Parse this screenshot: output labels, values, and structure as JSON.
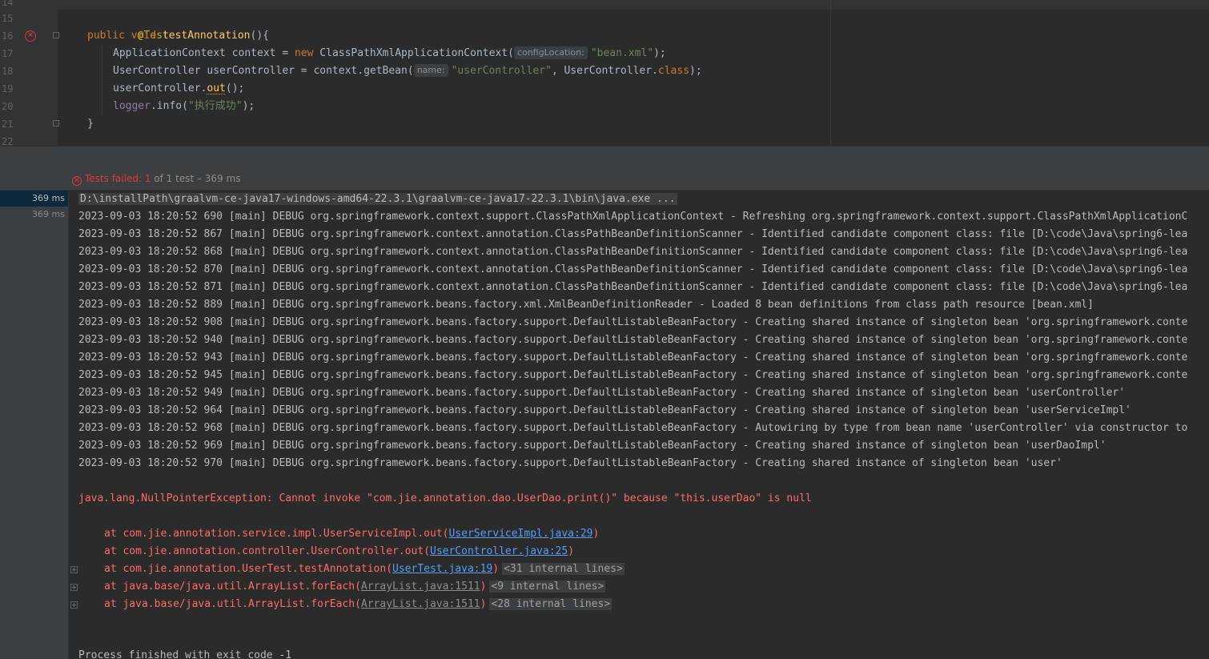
{
  "editor": {
    "line_numbers": [
      "14",
      "15",
      "16",
      "17",
      "18",
      "19",
      "20",
      "21",
      "22"
    ],
    "lines": {
      "l15": {
        "annotation": "@Test"
      },
      "l16": {
        "kw1": "public",
        "kw2": "void",
        "method": "testAnnotation",
        "rest": "(){"
      },
      "l17": {
        "t1": "ApplicationContext context = ",
        "kw": "new",
        "t2": " ClassPathXmlApplicationContext(",
        "hint": "configLocation:",
        "str": "\"bean.xml\"",
        "t3": ");"
      },
      "l18": {
        "t1": "UserController userController = context.getBean(",
        "hint": "name:",
        "str": "\"userController\"",
        "t2": ", UserController.",
        "kw": "class",
        "t3": ");"
      },
      "l19": {
        "t1": "userController.",
        "call": "out",
        "t2": "();"
      },
      "l20": {
        "field": "logger",
        "t1": ".info(",
        "str": "\"执行成功\"",
        "t2": ");"
      },
      "l21": {
        "t1": "}"
      }
    }
  },
  "run_status": {
    "label": "Tests failed:",
    "count": "1",
    "rest": "of 1 test – 369 ms"
  },
  "test_tree": {
    "rows": [
      "369 ms",
      "369 ms"
    ]
  },
  "console": {
    "command": "D:\\installPath\\graalvm-ce-java17-windows-amd64-22.3.1\\graalvm-ce-java17-22.3.1\\bin\\java.exe ...",
    "log_lines": [
      "2023-09-03 18:20:52 690 [main] DEBUG org.springframework.context.support.ClassPathXmlApplicationContext - Refreshing org.springframework.context.support.ClassPathXmlApplicationC",
      "2023-09-03 18:20:52 867 [main] DEBUG org.springframework.context.annotation.ClassPathBeanDefinitionScanner - Identified candidate component class: file [D:\\code\\Java\\spring6-lea",
      "2023-09-03 18:20:52 868 [main] DEBUG org.springframework.context.annotation.ClassPathBeanDefinitionScanner - Identified candidate component class: file [D:\\code\\Java\\spring6-lea",
      "2023-09-03 18:20:52 870 [main] DEBUG org.springframework.context.annotation.ClassPathBeanDefinitionScanner - Identified candidate component class: file [D:\\code\\Java\\spring6-lea",
      "2023-09-03 18:20:52 871 [main] DEBUG org.springframework.context.annotation.ClassPathBeanDefinitionScanner - Identified candidate component class: file [D:\\code\\Java\\spring6-lea",
      "2023-09-03 18:20:52 889 [main] DEBUG org.springframework.beans.factory.xml.XmlBeanDefinitionReader - Loaded 8 bean definitions from class path resource [bean.xml]",
      "2023-09-03 18:20:52 908 [main] DEBUG org.springframework.beans.factory.support.DefaultListableBeanFactory - Creating shared instance of singleton bean 'org.springframework.conte",
      "2023-09-03 18:20:52 940 [main] DEBUG org.springframework.beans.factory.support.DefaultListableBeanFactory - Creating shared instance of singleton bean 'org.springframework.conte",
      "2023-09-03 18:20:52 943 [main] DEBUG org.springframework.beans.factory.support.DefaultListableBeanFactory - Creating shared instance of singleton bean 'org.springframework.conte",
      "2023-09-03 18:20:52 945 [main] DEBUG org.springframework.beans.factory.support.DefaultListableBeanFactory - Creating shared instance of singleton bean 'org.springframework.conte",
      "2023-09-03 18:20:52 949 [main] DEBUG org.springframework.beans.factory.support.DefaultListableBeanFactory - Creating shared instance of singleton bean 'userController'",
      "2023-09-03 18:20:52 964 [main] DEBUG org.springframework.beans.factory.support.DefaultListableBeanFactory - Creating shared instance of singleton bean 'userServiceImpl'",
      "2023-09-03 18:20:52 968 [main] DEBUG org.springframework.beans.factory.support.DefaultListableBeanFactory - Autowiring by type from bean name 'userController' via constructor to",
      "2023-09-03 18:20:52 969 [main] DEBUG org.springframework.beans.factory.support.DefaultListableBeanFactory - Creating shared instance of singleton bean 'userDaoImpl'",
      "2023-09-03 18:20:52 970 [main] DEBUG org.springframework.beans.factory.support.DefaultListableBeanFactory - Creating shared instance of singleton bean 'user'"
    ],
    "exception": "java.lang.NullPointerException: Cannot invoke \"com.jie.annotation.dao.UserDao.print()\" because \"this.userDao\" is null",
    "stack": [
      {
        "prefix": "at com.jie.annotation.service.impl.UserServiceImpl.out(",
        "link": "UserServiceImpl.java:29",
        "suffix": ")",
        "internal": ""
      },
      {
        "prefix": "at com.jie.annotation.controller.UserController.out(",
        "link": "UserController.java:25",
        "suffix": ")",
        "internal": ""
      },
      {
        "prefix": "at com.jie.annotation.UserTest.testAnnotation(",
        "link": "UserTest.java:19",
        "suffix": ")",
        "internal": "<31 internal lines>"
      },
      {
        "prefix": "at java.base/java.util.ArrayList.forEach(",
        "link": "ArrayList.java:1511",
        "suffix": ")",
        "internal": "<9 internal lines>"
      },
      {
        "prefix": "at java.base/java.util.ArrayList.forEach(",
        "link": "ArrayList.java:1511",
        "suffix": ")",
        "internal": "<28 internal lines>"
      }
    ],
    "footer": "Process finished with exit code -1"
  }
}
